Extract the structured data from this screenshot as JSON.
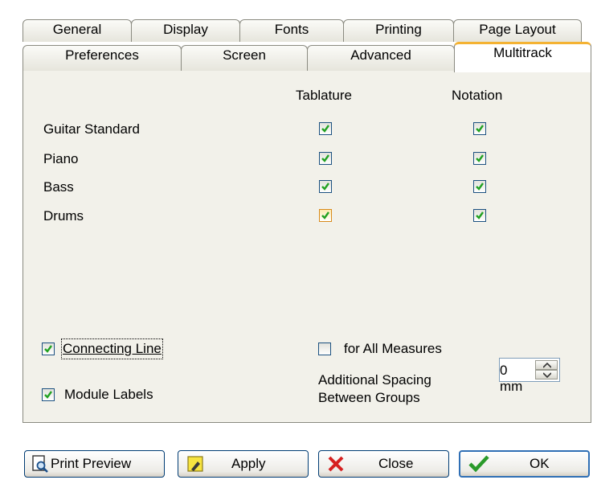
{
  "tabs_row1": [
    "General",
    "Display",
    "Fonts",
    "Printing",
    "Page Layout"
  ],
  "tabs_row2": [
    "Preferences",
    "Screen",
    "Advanced",
    "Multitrack"
  ],
  "active_tab": "Multitrack",
  "columns": {
    "tablature": "Tablature",
    "notation": "Notation"
  },
  "instruments": [
    {
      "name": "Guitar Standard",
      "tablature": true,
      "notation": true
    },
    {
      "name": "Piano",
      "tablature": true,
      "notation": true
    },
    {
      "name": "Bass",
      "tablature": true,
      "notation": true
    },
    {
      "name": "Drums",
      "tablature": true,
      "notation": true
    }
  ],
  "options": {
    "connecting_line": {
      "label": "Connecting Line",
      "checked": true
    },
    "for_all_measures": {
      "label": "for All Measures",
      "checked": false
    },
    "module_labels": {
      "label": "Module Labels",
      "checked": true
    },
    "spacing_label_line1": "Additional Spacing",
    "spacing_label_line2": "Between Groups",
    "spacing_value": "0 mm"
  },
  "buttons": {
    "print_preview": "Print Preview",
    "apply": "Apply",
    "close": "Close",
    "ok": "OK"
  },
  "colors": {
    "check_green": "#21a121",
    "active_tab_accent": "#f4b232",
    "page_background": "#f2f1ea"
  }
}
